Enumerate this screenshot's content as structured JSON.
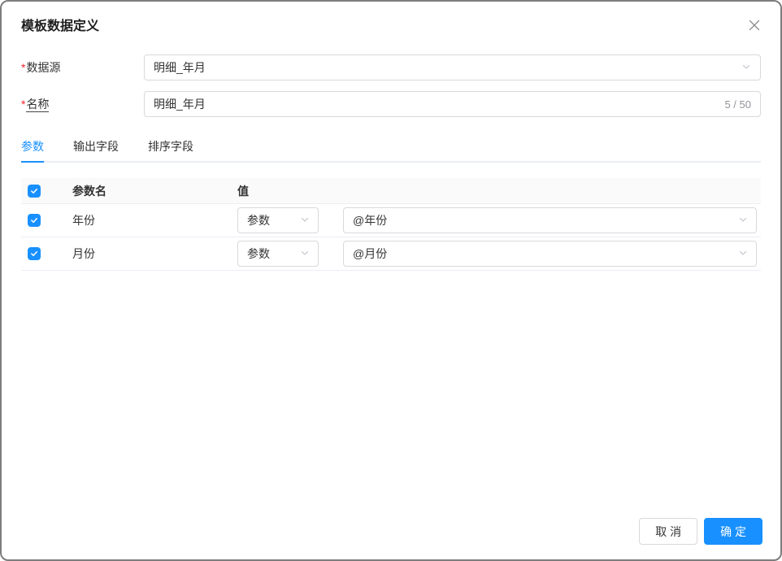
{
  "dialog": {
    "title": "模板数据定义"
  },
  "form": {
    "datasource": {
      "required_mark": "*",
      "label": "数据源",
      "value": "明细_年月"
    },
    "name": {
      "required_mark": "*",
      "label": "名称",
      "value": "明细_年月",
      "counter": "5 / 50"
    }
  },
  "tabs": [
    {
      "label": "参数",
      "active": true
    },
    {
      "label": "输出字段",
      "active": false
    },
    {
      "label": "排序字段",
      "active": false
    }
  ],
  "table": {
    "headers": {
      "param_name": "参数名",
      "value": "值"
    },
    "rows": [
      {
        "checked": true,
        "name": "年份",
        "type": "参数",
        "value": "@年份"
      },
      {
        "checked": true,
        "name": "月份",
        "type": "参数",
        "value": "@月份"
      }
    ]
  },
  "footer": {
    "cancel_label": "取 消",
    "confirm_label": "确 定"
  },
  "colors": {
    "accent": "#1890ff",
    "required": "#f5222d",
    "border": "#d9d9d9",
    "divider": "#ebeef5",
    "header_bg": "#fafafa",
    "text": "#333333",
    "muted": "#909399",
    "chevron": "#c0c4cc"
  }
}
